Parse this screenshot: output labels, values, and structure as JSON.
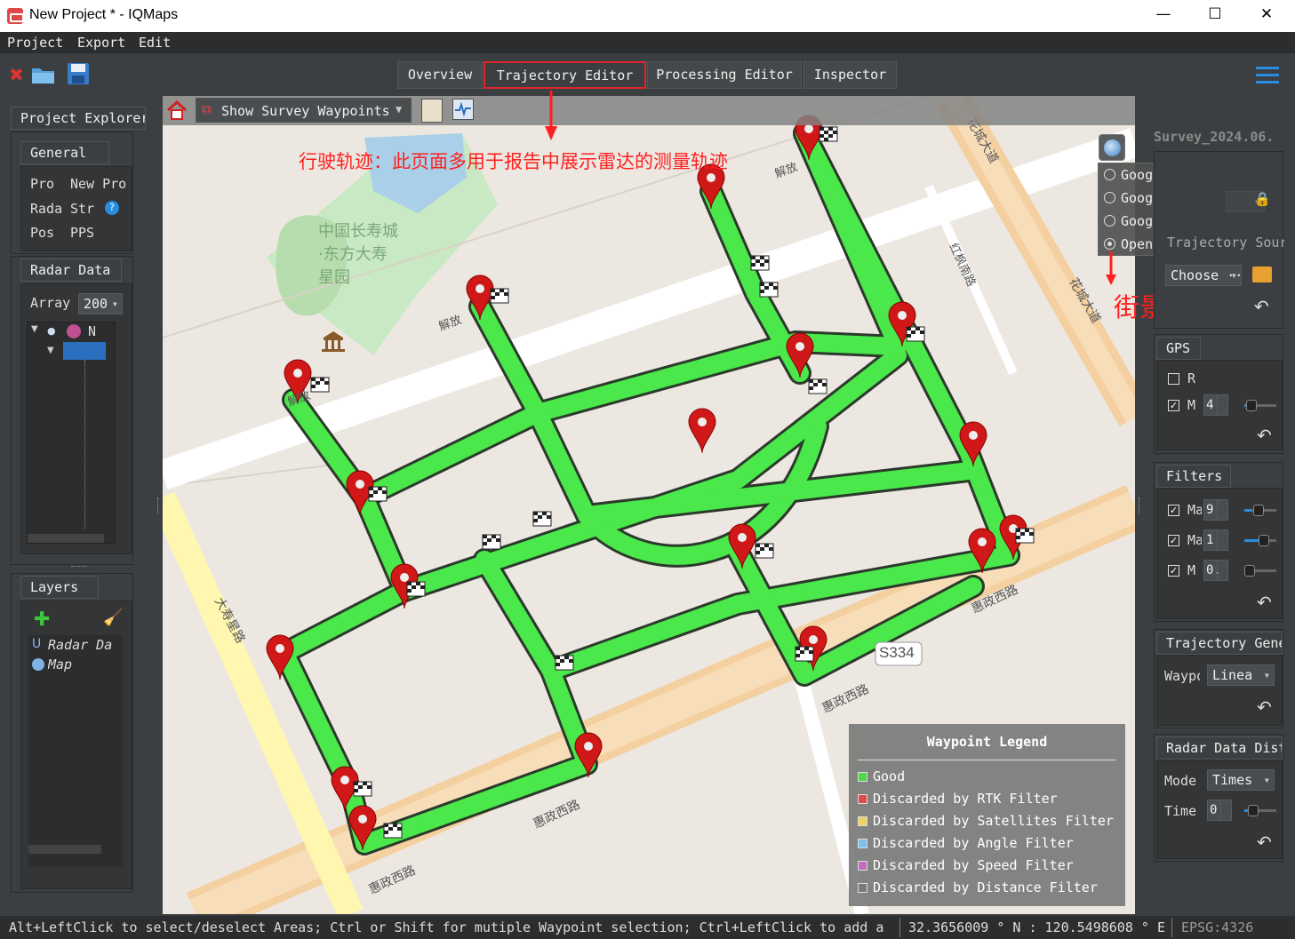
{
  "window": {
    "title": "New Project * - IQMaps",
    "minimize": "—",
    "maximize": "☐",
    "close": "✕"
  },
  "menu": {
    "project": "Project",
    "export": "Export",
    "edit": "Edit"
  },
  "tabs": {
    "overview": "Overview",
    "trajectory_editor": "Trajectory Editor",
    "processing_editor": "Processing Editor",
    "inspector": "Inspector"
  },
  "left": {
    "project_explorer": "Project Explorer",
    "general": {
      "header": "General",
      "rows": [
        {
          "key": "Pro",
          "val": "New Pro"
        },
        {
          "key": "Rada",
          "val": "Str"
        },
        {
          "key": "Pos",
          "val": "PPS"
        }
      ]
    },
    "radar_data": {
      "header": "Radar Data",
      "array_label": "Array",
      "array_value": "200",
      "tree_root": "N"
    },
    "layers": {
      "header": "Layers",
      "items": [
        "Radar Da",
        "Map"
      ]
    }
  },
  "map": {
    "show_waypoints": "Show Survey Waypoints",
    "annotation_top": "行驶轨迹：此页面多用于报告中展示雷达的测量轨迹",
    "annotation_right": "街景地图",
    "labels": {
      "park": "中国长寿城·东方大寿星园",
      "road_jiefang1": "解放",
      "road_jiefang2": "解放",
      "road_jiefang3": "解放",
      "road_huacheng1": "花城大道",
      "road_huacheng2": "花城大道",
      "road_hongfeng": "红枫南路",
      "road_huizheng1": "惠政西路",
      "road_huizheng2": "惠政西路",
      "road_huizheng3": "惠政西路",
      "road_huizheng4": "惠政西路",
      "road_dashou": "大寿星路",
      "route_s334": "S334"
    },
    "base_maps": [
      "Google Hybrid",
      "Google Maps",
      "Google Satellite",
      "OpenStreetMap"
    ],
    "base_selected": "OpenStreetMap",
    "legend": {
      "title": "Waypoint Legend",
      "items": [
        {
          "label": "Good",
          "color": "#4cd94c"
        },
        {
          "label": "Discarded by RTK Filter",
          "color": "#e04a4a"
        },
        {
          "label": "Discarded by Satellites Filter",
          "color": "#f0d060"
        },
        {
          "label": "Discarded by Angle Filter",
          "color": "#7cc0f0"
        },
        {
          "label": "Discarded by Speed Filter",
          "color": "#c070c0"
        },
        {
          "label": "Discarded by Distance Filter",
          "color": "#7a7a7a"
        }
      ]
    }
  },
  "right": {
    "survey": "Survey_2024.06.",
    "trajectory_source": "Trajectory Sour",
    "choose": "Choose",
    "choose_more": "···",
    "gps": {
      "header": "GPS",
      "rtk": "R",
      "ms": "M",
      "ms_value": "4"
    },
    "filters": {
      "header": "Filters",
      "rows": [
        {
          "label": "Ma",
          "value": "9"
        },
        {
          "label": "Ma",
          "value": "1"
        },
        {
          "label": "M",
          "value": "0."
        }
      ]
    },
    "trajectory_gen": {
      "header": "Trajectory Gene",
      "waypoint_label": "Waypo",
      "waypoint_value": "Linea"
    },
    "radar_dist": {
      "header": "Radar Data Dist",
      "mode_label": "Mode",
      "mode_value": "Times",
      "time_label": "Time",
      "time_value": "0"
    }
  },
  "status": {
    "hint": "Alt+LeftClick to select/deselect Areas; Ctrl or Shift for mutiple Waypoint selection; Ctrl+LeftClick to add a",
    "coords": "32.3656009 ° N : 120.5498608 ° E",
    "epsg": "EPSG:4326"
  },
  "colors": {
    "accent_red": "#e0242c",
    "trajectory_green": "#4ae84a",
    "panel_bg": "#3c3f41"
  }
}
